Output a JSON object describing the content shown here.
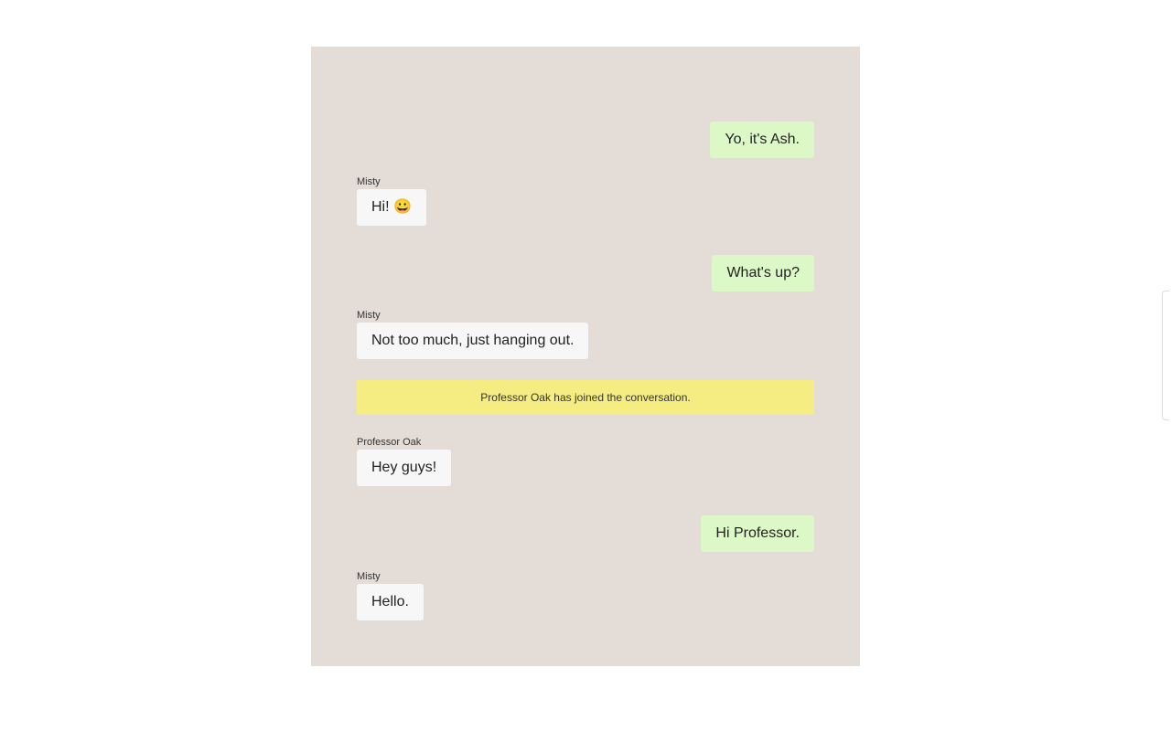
{
  "messages": [
    {
      "direction": "out",
      "text": "Yo, it's Ash."
    },
    {
      "direction": "in",
      "sender": "Misty",
      "text": "Hi! 😀"
    },
    {
      "direction": "out",
      "text": "What's up?"
    },
    {
      "direction": "in",
      "sender": "Misty",
      "text": "Not too much, just hanging out."
    },
    {
      "direction": "in",
      "sender": "Professor Oak",
      "text": "Hey guys!"
    },
    {
      "direction": "out",
      "text": "Hi Professor."
    },
    {
      "direction": "in",
      "sender": "Misty",
      "text": "Hello."
    }
  ],
  "system_notice": "Professor Oak has joined the conversation.",
  "colors": {
    "chat_background": "#e4dcd7",
    "outgoing_bubble": "#dcf8c6",
    "incoming_bubble": "#f7f7f7",
    "system_notice": "#f5ec82"
  }
}
